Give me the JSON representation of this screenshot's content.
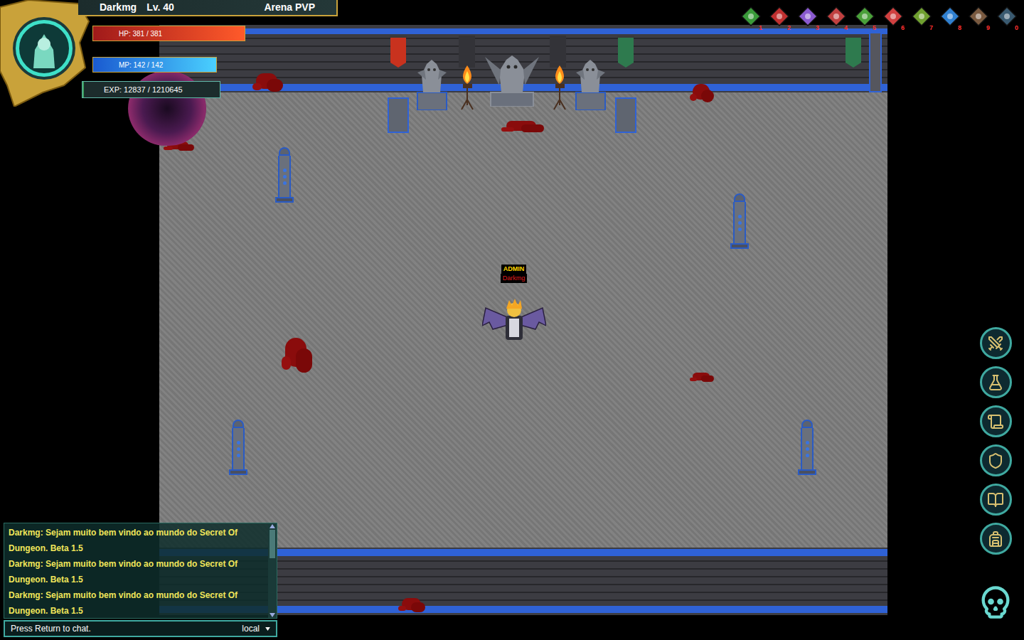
{
  "hud": {
    "name": "Darkmg",
    "level": "Lv. 40",
    "map": "Arena PVP",
    "hp": {
      "label": "HP: 381 / 381",
      "level": 1
    },
    "mp": {
      "label": "MP: 142 / 142",
      "level": 1
    },
    "exp": {
      "label": "EXP: 12837 / 1210645",
      "level": 0.0106
    }
  },
  "hotbar": [
    {
      "key": "1"
    },
    {
      "key": "2"
    },
    {
      "key": "3"
    },
    {
      "key": "4"
    },
    {
      "key": "5"
    },
    {
      "key": "6"
    },
    {
      "key": "7"
    },
    {
      "key": "8"
    },
    {
      "key": "9"
    },
    {
      "key": "0"
    }
  ],
  "player": {
    "tag": "ADMIN",
    "name": "Darkmg"
  },
  "chat": {
    "messages": [
      "Darkmg: Sejam muito bem vindo ao mundo do Secret Of Dungeon. Beta 1.5",
      "Darkmg: Sejam muito bem vindo ao mundo do Secret Of Dungeon. Beta 1.5",
      "Darkmg: Sejam muito bem vindo ao mundo do Secret Of Dungeon. Beta 1.5"
    ],
    "input_placeholder": "Press Return to chat.",
    "channel": "local"
  }
}
